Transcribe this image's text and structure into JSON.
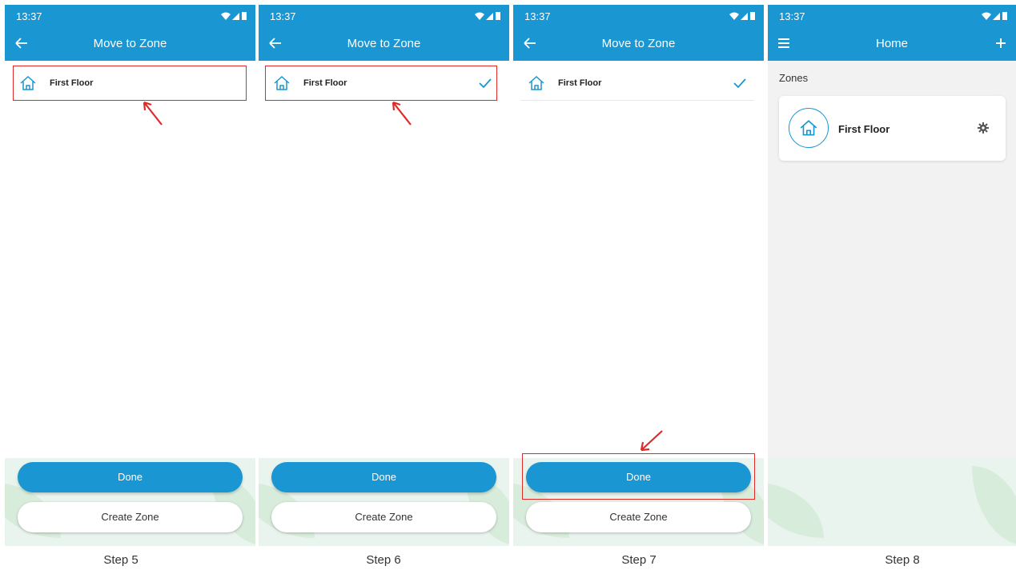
{
  "colors": {
    "brand": "#1a96d2",
    "highlight": "#e02a2a"
  },
  "statusbar": {
    "time": "13:37",
    "icons": [
      "wifi-icon",
      "signal-icon",
      "battery-icon"
    ]
  },
  "move_to_zone": {
    "title": "Move to Zone",
    "zone_name": "First Floor",
    "done_label": "Done",
    "create_label": "Create Zone"
  },
  "home": {
    "title": "Home",
    "zones_label": "Zones",
    "zone_name": "First Floor"
  },
  "steps": [
    "Step 5",
    "Step 6",
    "Step 7",
    "Step 8"
  ]
}
